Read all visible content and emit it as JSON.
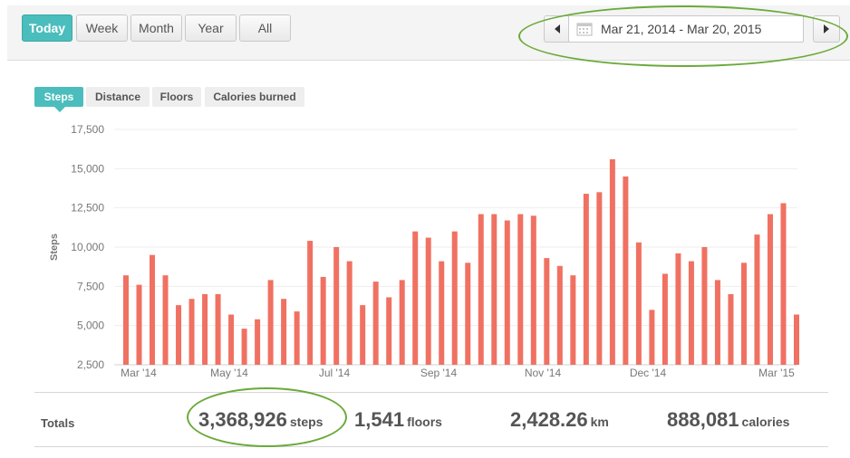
{
  "range_buttons": [
    {
      "label": "Today",
      "active": true
    },
    {
      "label": "Week",
      "active": false
    },
    {
      "label": "Month",
      "active": false
    },
    {
      "label": "Year",
      "active": false
    },
    {
      "label": "All",
      "active": false
    }
  ],
  "date_range": "Mar 21, 2014 - Mar 20, 2015",
  "metric_tabs": [
    {
      "label": "Steps",
      "active": true
    },
    {
      "label": "Distance",
      "active": false
    },
    {
      "label": "Floors",
      "active": false
    },
    {
      "label": "Calories burned",
      "active": false
    }
  ],
  "colors": {
    "accent": "#4bbdbd",
    "bar": "#f07162",
    "annotation": "#6aaa3a"
  },
  "icons": {
    "prev": "triangle-left-icon",
    "next": "triangle-right-icon",
    "calendar": "calendar-icon"
  },
  "chart_data": {
    "type": "bar",
    "ylabel": "Steps",
    "ylim": [
      2500,
      17500
    ],
    "yticks": [
      "17,500",
      "15,000",
      "12,500",
      "10,000",
      "7,500",
      "5,000",
      "2,500"
    ],
    "xtick_labels": [
      "Mar '14",
      "May '14",
      "Jul '14",
      "Sep '14",
      "Nov '14",
      "Dec '14",
      "Mar '15"
    ],
    "values": [
      8200,
      7600,
      9500,
      8200,
      6300,
      6700,
      7000,
      7000,
      5700,
      4800,
      5400,
      7900,
      6700,
      5900,
      10400,
      8100,
      10000,
      9100,
      6300,
      7800,
      6800,
      7900,
      11000,
      10600,
      9100,
      11000,
      9000,
      12100,
      12100,
      11700,
      12100,
      12000,
      9300,
      8800,
      8200,
      13400,
      13500,
      15600,
      14500,
      10300,
      6000,
      8300,
      9600,
      9100,
      10000,
      7900,
      7000,
      9000,
      10800,
      12100,
      12800,
      5700
    ],
    "grid": true,
    "legend": "none"
  },
  "totals": {
    "label": "Totals",
    "steps": {
      "value": "3,368,926",
      "unit": "steps"
    },
    "floors": {
      "value": "1,541",
      "unit": "floors"
    },
    "distance": {
      "value": "2,428.26",
      "unit": "km"
    },
    "calories": {
      "value": "888,081",
      "unit": "calories"
    }
  }
}
